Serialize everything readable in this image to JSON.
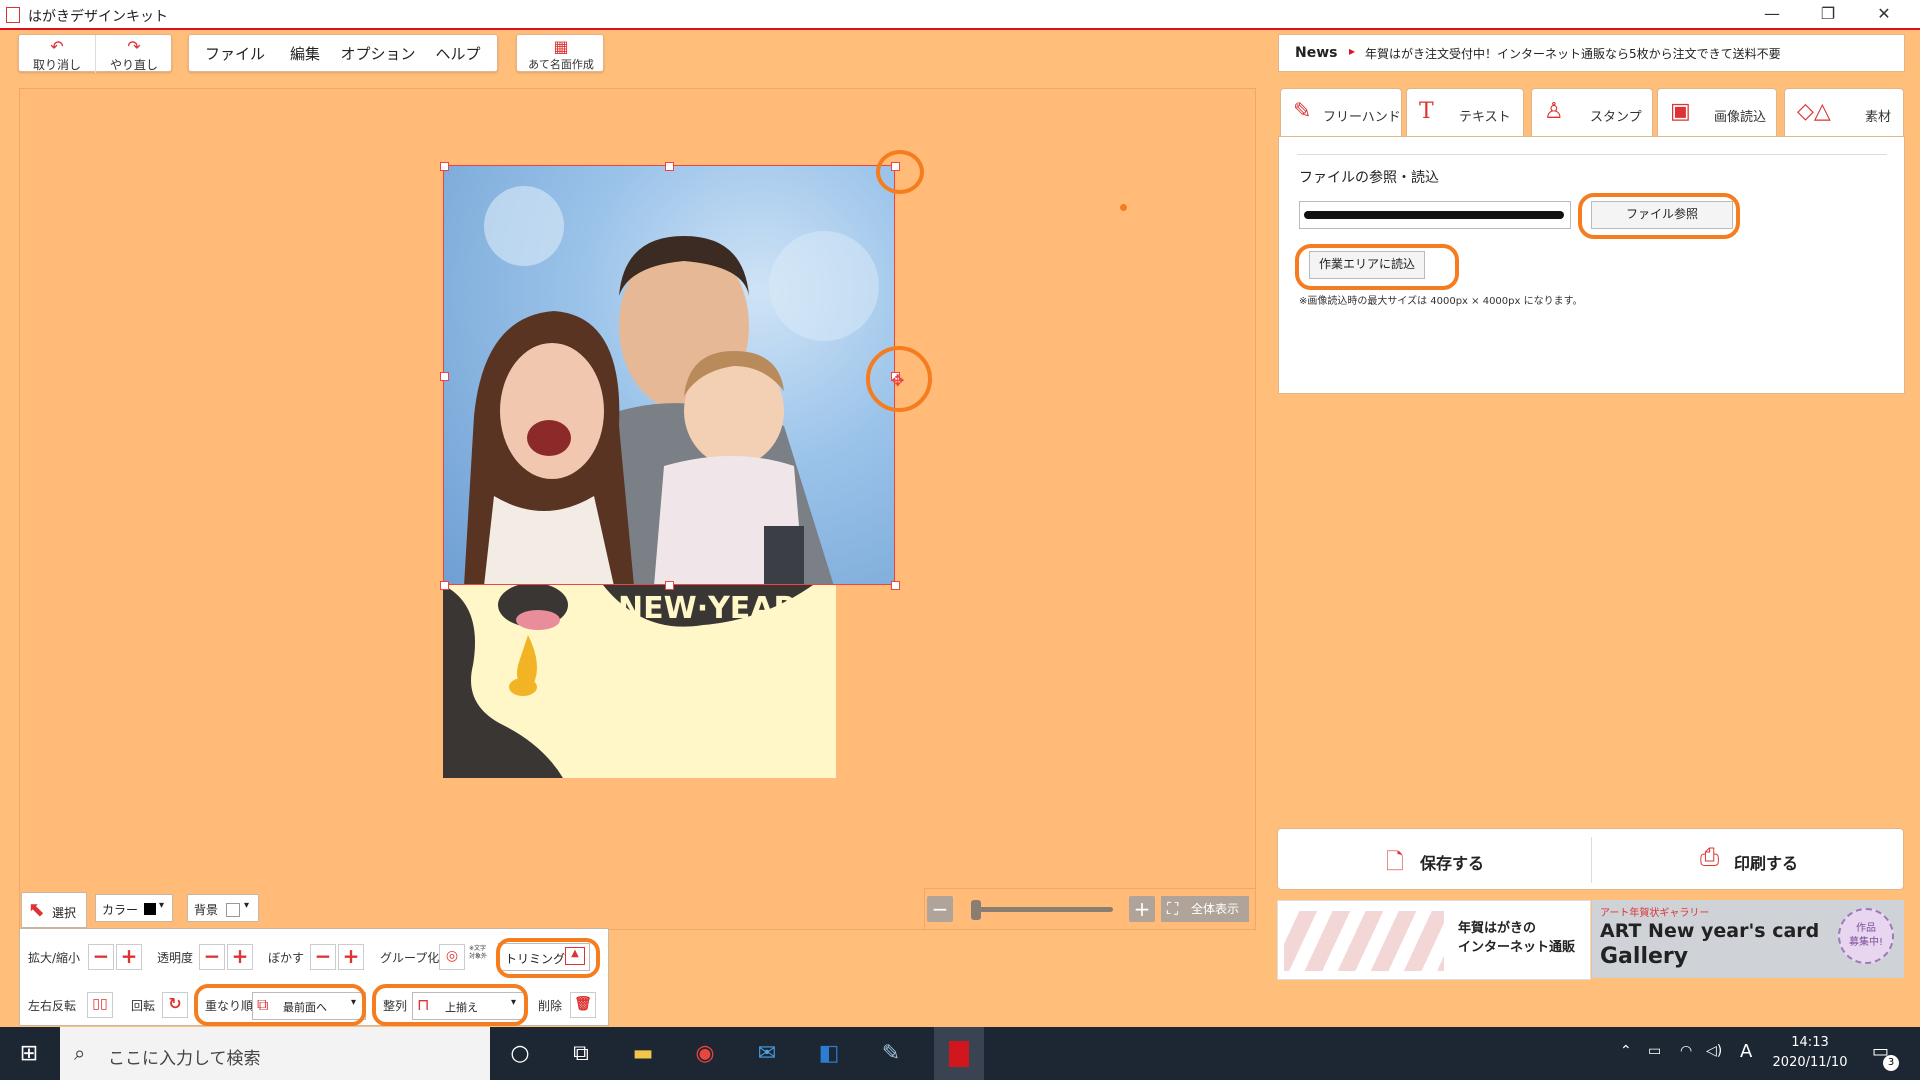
{
  "window": {
    "title": "はがきデザインキット",
    "controls": {
      "minimize": "—",
      "restore": "❐",
      "close": "✕"
    }
  },
  "toolbar": {
    "undo": "取り消し",
    "redo": "やり直し",
    "menus": [
      "ファイル",
      "編集",
      "オプション",
      "ヘルプ"
    ],
    "address": "あて名面作成"
  },
  "news": {
    "label": "News",
    "arrow": "▸",
    "text": "年賀はがき注文受付中！インターネット通販なら5枚から注文できて送料不要"
  },
  "tabs": [
    {
      "label": "フリーハンド",
      "icon": "pencil-icon"
    },
    {
      "label": "テキスト",
      "icon": "text-icon"
    },
    {
      "label": "スタンプ",
      "icon": "stamp-icon"
    },
    {
      "label": "画像読込",
      "icon": "image-icon"
    },
    {
      "label": "素材",
      "icon": "shapes-icon"
    }
  ],
  "panel": {
    "heading": "ファイルの参照・読込",
    "file_browse": "ファイル参照",
    "load_to_work": "作業エリアに読込",
    "note": "※画像読込時の最大サイズは 4000px × 4000px になります。"
  },
  "actions": {
    "save": "保存する",
    "print": "印刷する"
  },
  "ads": {
    "left": "年賀はがきの\nインターネット通販",
    "right_small": "アート年賀状ギャラリー",
    "right_title": "ART New year's card",
    "right_sub": "Gallery",
    "right_badge": "作品\n募集中!"
  },
  "card": {
    "text": "NEW·YEAR"
  },
  "zoom": {
    "fit": "全体表示",
    "minus": "−",
    "plus": "+"
  },
  "tools": {
    "select": "選択",
    "color": "カラー",
    "background": "背景",
    "scale": "拡大/縮小",
    "opacity": "透明度",
    "blur": "ぼかす",
    "group": "グループ化",
    "group_note": "※文字対象外",
    "trimming": "トリミング",
    "flip": "左右反転",
    "rotate": "回転",
    "order": "重なり順",
    "order_value": "最前面へ",
    "align": "整列",
    "align_value": "上揃え",
    "delete": "削除"
  },
  "taskbar": {
    "search_placeholder": "ここに入力して検索",
    "time": "14:13",
    "date": "2020/11/10",
    "ime": "A",
    "notifications": "3"
  },
  "colors": {
    "accent": "#e0101e",
    "canvas": "#ffbb77",
    "highlight": "#f57c1f"
  }
}
